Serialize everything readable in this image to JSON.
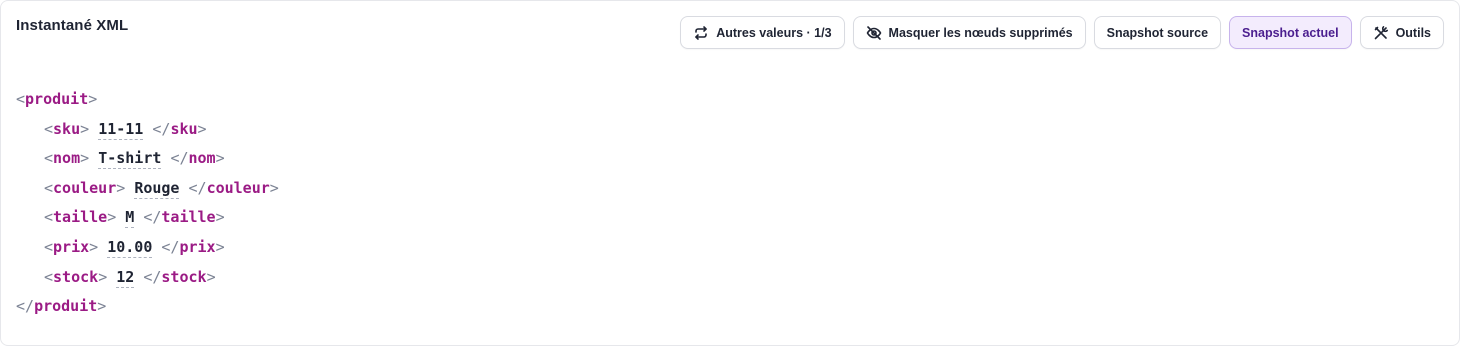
{
  "header": {
    "title": "Instantané XML"
  },
  "toolbar": {
    "other_values": "Autres valeurs · 1/3",
    "hide_deleted": "Masquer les nœuds supprimés",
    "snapshot_source": "Snapshot source",
    "snapshot_current": "Snapshot actuel",
    "tools": "Outils"
  },
  "colors": {
    "tag": "#9b1b85",
    "punct": "#7c8394",
    "active_bg": "#f3ecfd",
    "active_text": "#4b1e8f"
  },
  "xml": {
    "root": "produit",
    "fields": [
      {
        "tag": "sku",
        "value": "11-11"
      },
      {
        "tag": "nom",
        "value": "T-shirt"
      },
      {
        "tag": "couleur",
        "value": "Rouge"
      },
      {
        "tag": "taille",
        "value": "M"
      },
      {
        "tag": "prix",
        "value": "10.00"
      },
      {
        "tag": "stock",
        "value": "12"
      }
    ]
  }
}
